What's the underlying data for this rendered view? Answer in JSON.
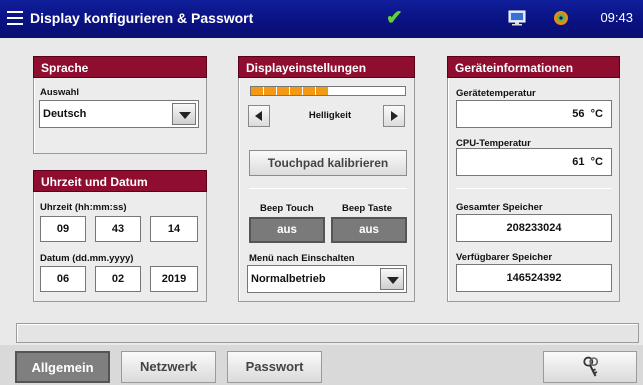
{
  "titlebar": {
    "title": "Display konfigurieren & Passwort",
    "time": "09:43",
    "icons": [
      "menu-icon",
      "check-icon",
      "monitor-icon",
      "gear-icon"
    ]
  },
  "language": {
    "header": "Sprache",
    "select_label": "Auswahl",
    "selected": "Deutsch"
  },
  "datetime": {
    "header": "Uhrzeit und Datum",
    "time_label": "Uhrzeit (hh:mm:ss)",
    "hour": "09",
    "minute": "43",
    "second": "14",
    "date_label": "Datum (dd.mm.yyyy)",
    "day": "06",
    "month": "02",
    "year": "2019"
  },
  "display": {
    "header": "Displayeinstellungen",
    "brightness_label": "Helligkeit",
    "brightness_level": 0.5,
    "calibrate_button": "Touchpad kalibrieren",
    "beep_touch_label": "Beep Touch",
    "beep_touch_value": "aus",
    "beep_key_label": "Beep Taste",
    "beep_key_value": "aus",
    "startup_menu_label": "Menü nach Einschalten",
    "startup_menu_value": "Normalbetrieb"
  },
  "device_info": {
    "header": "Geräteinformationen",
    "device_temp_label": "Gerätetemperatur",
    "device_temp_value": "56  °C",
    "cpu_temp_label": "CPU-Temperatur",
    "cpu_temp_value": "61  °C",
    "total_memory_label": "Gesamter Speicher",
    "total_memory_value": "208233024",
    "free_memory_label": "Verfügbarer Speicher",
    "free_memory_value": "146524392"
  },
  "tabs": [
    {
      "label": "Allgemein",
      "active": true
    },
    {
      "label": "Netzwerk",
      "active": false
    },
    {
      "label": "Passwort",
      "active": false
    }
  ],
  "colors": {
    "titlebar": "#0a1180",
    "panel_header": "#8f0d2f",
    "progress": "#f49a12",
    "check": "#5fd13a"
  }
}
